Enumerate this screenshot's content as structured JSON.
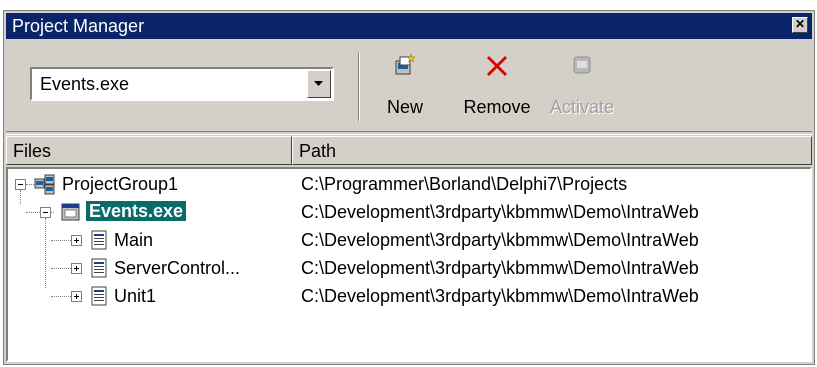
{
  "window": {
    "title": "Project Manager"
  },
  "toolbar": {
    "combo_value": "Events.exe",
    "buttons": [
      {
        "label": "New",
        "icon": "new-project-icon",
        "enabled": true
      },
      {
        "label": "Remove",
        "icon": "remove-x-icon",
        "enabled": true
      },
      {
        "label": "Activate",
        "icon": "activate-icon",
        "enabled": false
      }
    ]
  },
  "columns": {
    "files": "Files",
    "path": "Path"
  },
  "tree": [
    {
      "name": "ProjectGroup1",
      "path": "C:\\Programmer\\Borland\\Delphi7\\Projects",
      "level": 0,
      "expander": "minus",
      "icon": "project-group-icon",
      "selected": false
    },
    {
      "name": "Events.exe",
      "path": "C:\\Development\\3rdparty\\kbmmw\\Demo\\IntraWeb",
      "level": 1,
      "expander": "minus",
      "icon": "application-icon",
      "selected": true
    },
    {
      "name": "Main",
      "path": "C:\\Development\\3rdparty\\kbmmw\\Demo\\IntraWeb",
      "level": 2,
      "expander": "plus",
      "icon": "unit-file-icon",
      "selected": false
    },
    {
      "name": "ServerControl...",
      "path": "C:\\Development\\3rdparty\\kbmmw\\Demo\\IntraWeb",
      "level": 2,
      "expander": "plus",
      "icon": "unit-file-icon",
      "selected": false
    },
    {
      "name": "Unit1",
      "path": "C:\\Development\\3rdparty\\kbmmw\\Demo\\IntraWeb",
      "level": 2,
      "expander": "plus",
      "icon": "unit-file-icon",
      "selected": false
    }
  ],
  "colors": {
    "titlebar": "#0a246a",
    "selection": "#0a6b6b",
    "face": "#d4d0c8",
    "remove_red": "#e00000"
  }
}
